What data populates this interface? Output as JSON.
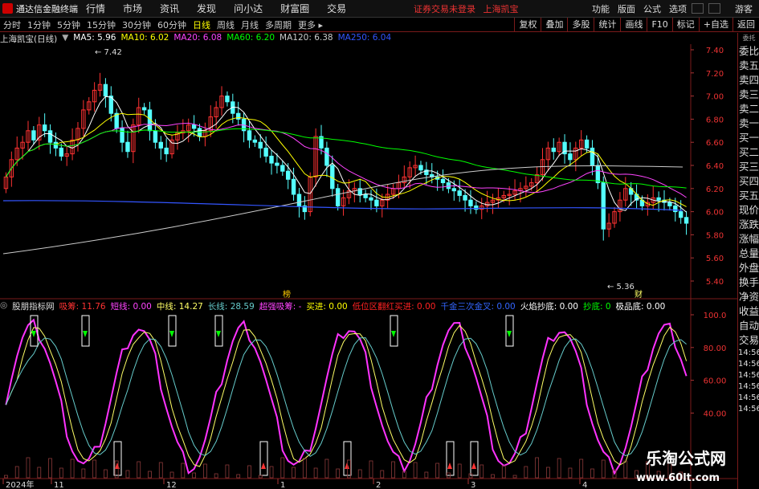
{
  "menubar": {
    "app_title": "通达信金融终端",
    "items": [
      "行情",
      "市场",
      "资讯",
      "发现",
      "问小达",
      "财富圈",
      "交易"
    ],
    "notice": "证券交易未登录",
    "stock_notice": "上海凯宝",
    "right_items": [
      "功能",
      "版面",
      "公式",
      "选项"
    ],
    "user": "游客"
  },
  "periodbar": {
    "items": [
      "分时",
      "1分钟",
      "5分钟",
      "15分钟",
      "30分钟",
      "60分钟",
      "日线",
      "周线",
      "月线",
      "多周期",
      "更多"
    ],
    "active": "日线",
    "tools": [
      "复权",
      "叠加",
      "多股",
      "统计",
      "画线",
      "F10",
      "标记",
      "+自选",
      "返回"
    ]
  },
  "main_chart": {
    "stock": "上海凯宝(日线)",
    "ma": [
      {
        "label": "MA5: 5.96",
        "color": "#ffffff"
      },
      {
        "label": "MA10: 6.02",
        "color": "#ffff00"
      },
      {
        "label": "MA20: 6.08",
        "color": "#ff44ff"
      },
      {
        "label": "MA60: 6.20",
        "color": "#00ff00"
      },
      {
        "label": "MA120: 6.38",
        "color": "#cccccc"
      },
      {
        "label": "MA250: 6.04",
        "color": "#3355ff"
      }
    ],
    "price_ticks": [
      "7.40",
      "7.20",
      "7.00",
      "6.80",
      "6.60",
      "6.40",
      "6.20",
      "6.00",
      "5.80",
      "5.60",
      "5.40"
    ],
    "high_label": "7.42",
    "low_label": "5.36",
    "marker_bang": "榜",
    "marker_cai": "财"
  },
  "indicator": {
    "name": "股朋指标网",
    "fields": [
      {
        "label": "吸筹: 11.76",
        "color": "#ff3333"
      },
      {
        "label": "短线: 0.00",
        "color": "#ff44ff"
      },
      {
        "label": "中线: 14.27",
        "color": "#ffff66"
      },
      {
        "label": "长线: 28.59",
        "color": "#66cccc"
      },
      {
        "label": "超强吸筹: -",
        "color": "#ff44ff"
      },
      {
        "label": "买进: 0.00",
        "color": "#ffff00"
      },
      {
        "label": "低位区翻红买进: 0.00",
        "color": "#ff2222"
      },
      {
        "label": "千金三次金叉: 0.00",
        "color": "#3366ff"
      },
      {
        "label": "火焰抄底: 0.00",
        "color": "#ffffff"
      },
      {
        "label": "抄底: 0",
        "color": "#00ff00"
      },
      {
        "label": "极品底: 0.00",
        "color": "#ffffff"
      }
    ],
    "ticks": [
      "100.0",
      "80.00",
      "60.00",
      "40.00"
    ]
  },
  "date_axis": [
    "2024年",
    "11",
    "12",
    "1",
    "2",
    "3",
    "4"
  ],
  "right_panel": {
    "top_label": "委托",
    "items": [
      "委比",
      "卖五",
      "卖四",
      "卖三",
      "卖二",
      "卖一",
      "买一",
      "买二",
      "买三",
      "买四",
      "买五",
      "现价",
      "涨跌",
      "涨幅",
      "总量",
      "外盘",
      "换手",
      "净资",
      "收益",
      "自动",
      "交易",
      "14:56",
      "14:56",
      "14:56",
      "14:56",
      "14:56",
      "14:56"
    ]
  },
  "watermark": {
    "line1": "乐淘公式网",
    "line2": "www.60lt.com"
  }
}
